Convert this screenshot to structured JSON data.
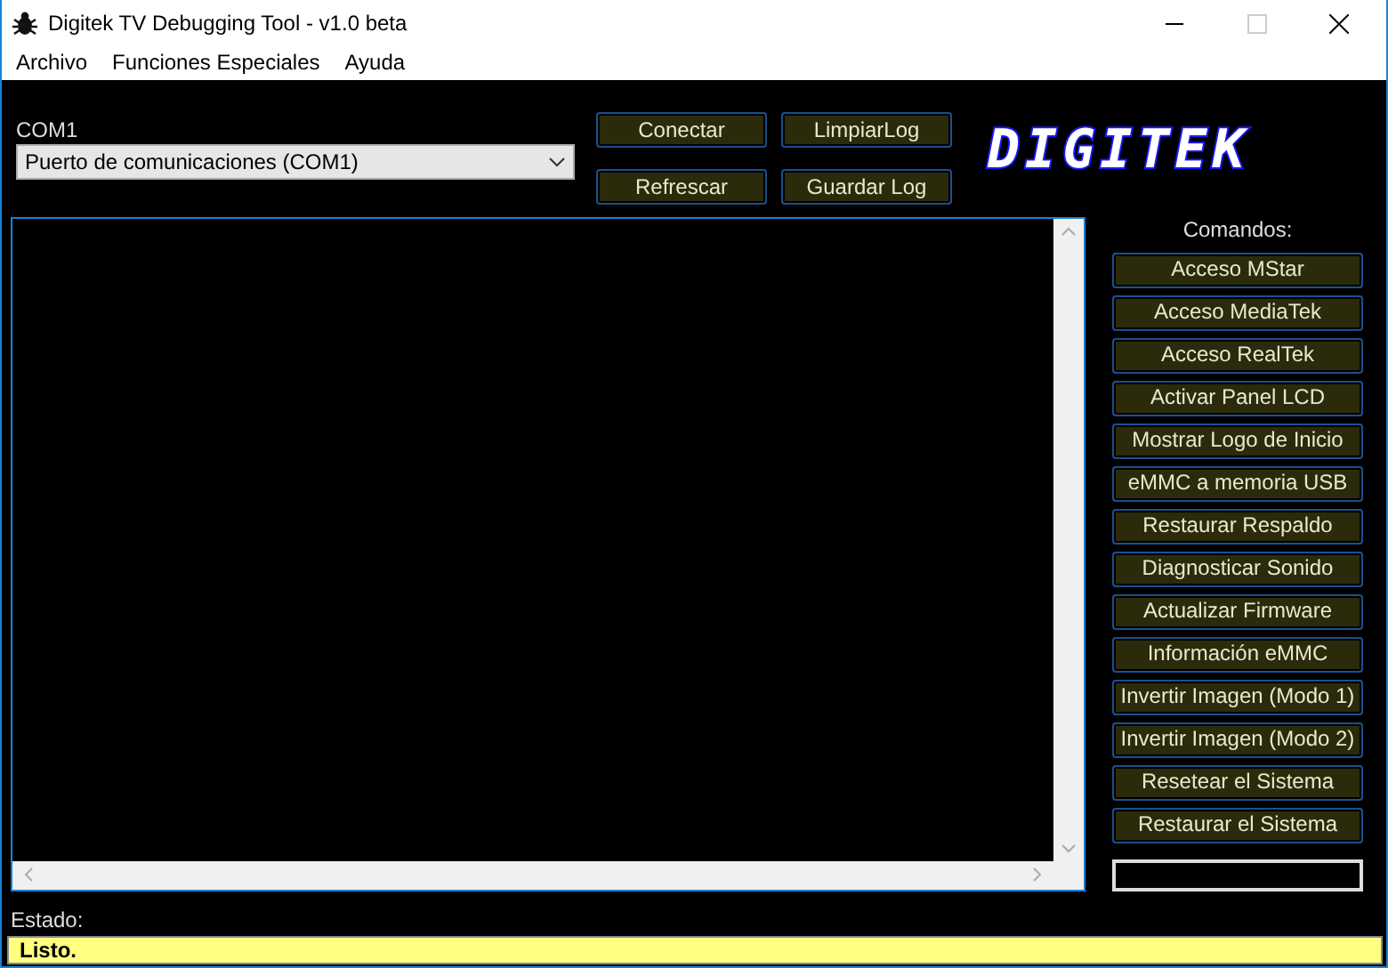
{
  "window": {
    "title": "Digitek TV Debugging Tool - v1.0 beta"
  },
  "menu": [
    "Archivo",
    "Funciones Especiales",
    "Ayuda"
  ],
  "port": {
    "label": "COM1",
    "value": "Puerto de comunicaciones (COM1)"
  },
  "top_buttons": [
    [
      "Conectar",
      "LimpiarLog"
    ],
    [
      "Refrescar",
      "Guardar Log"
    ]
  ],
  "logo": "DIGITEK",
  "commands": {
    "label": "Comandos:",
    "buttons": [
      "Acceso MStar",
      "Acceso MediaTek",
      "Acceso RealTek",
      "Activar Panel LCD",
      "Mostrar Logo de Inicio",
      "eMMC a memoria USB",
      "Restaurar Respaldo",
      "Diagnosticar Sonido",
      "Actualizar Firmware",
      "Información eMMC",
      "Invertir Imagen (Modo 1)",
      "Invertir Imagen (Modo 2)",
      "Resetear el Sistema",
      "Restaurar el Sistema"
    ]
  },
  "status": {
    "label": "Estado:",
    "text": "Listo."
  }
}
